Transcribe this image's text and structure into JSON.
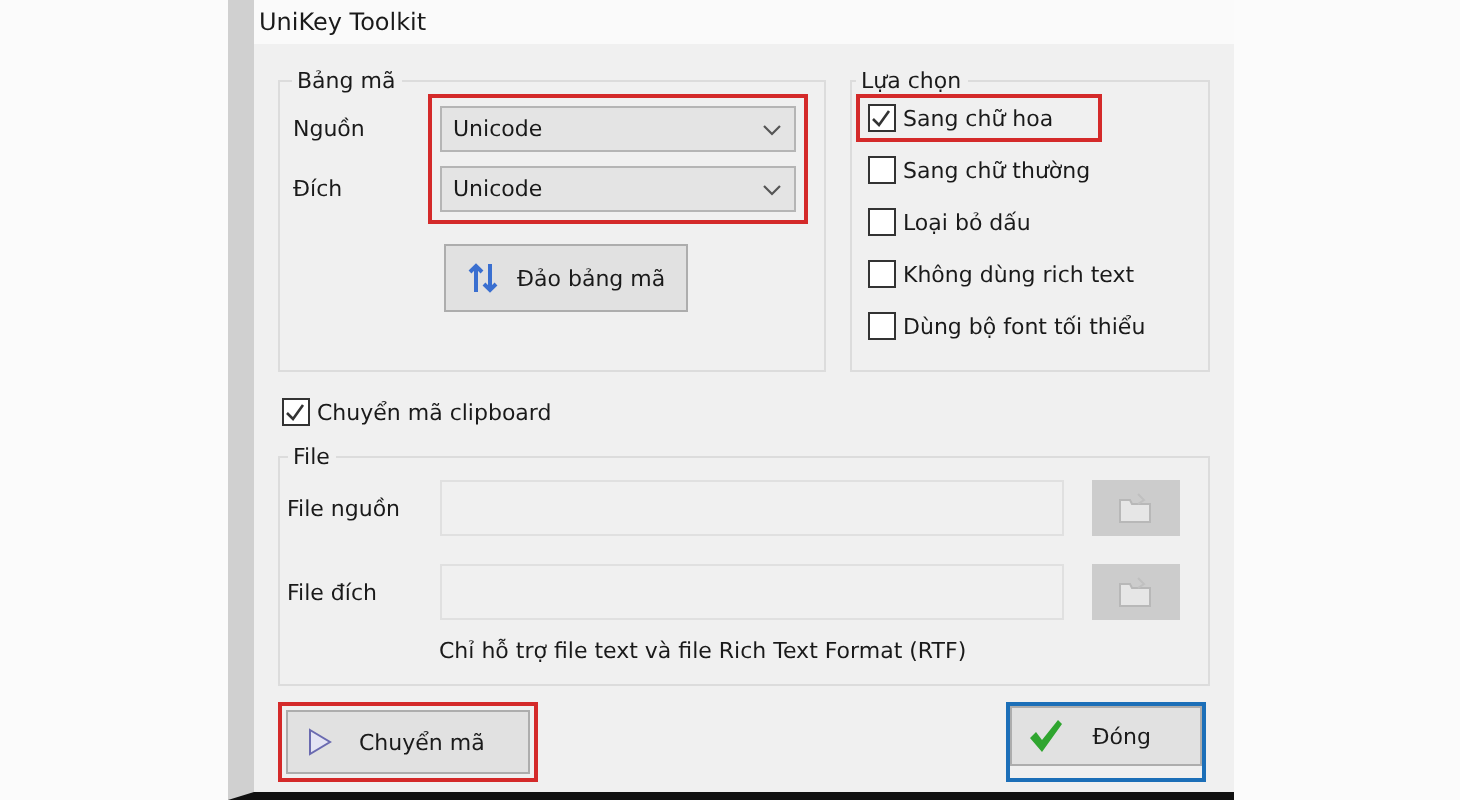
{
  "window": {
    "title": "UniKey Toolkit"
  },
  "code_table": {
    "label": "Bảng mã",
    "highlighted": true,
    "fields": [
      {
        "label": "Nguồn",
        "value": "Unicode"
      },
      {
        "label": "Đích",
        "value": "Unicode"
      }
    ],
    "swap_button": "Đảo bảng mã"
  },
  "options": {
    "label": "Lựa chọn",
    "items": [
      {
        "label": "Sang chữ hoa",
        "checked": true,
        "highlighted": true
      },
      {
        "label": "Sang chữ thường",
        "checked": false,
        "highlighted": false
      },
      {
        "label": "Loại bỏ dấu",
        "checked": false,
        "highlighted": false
      },
      {
        "label": "Không dùng rich text",
        "checked": false,
        "highlighted": false
      },
      {
        "label": "Dùng bộ font tối thiểu",
        "checked": false,
        "highlighted": false
      }
    ]
  },
  "clipboard": {
    "label": "Chuyển mã clipboard",
    "checked": true
  },
  "file": {
    "label": "File",
    "fields": [
      {
        "label": "File nguồn"
      },
      {
        "label": "File đích"
      }
    ],
    "note": "Chỉ hỗ trợ file text và file Rich Text Format (RTF)"
  },
  "buttons": [
    {
      "label": "Chuyển mã",
      "kind": "convert",
      "highlighted": true,
      "default": false
    },
    {
      "label": "Đóng",
      "kind": "close",
      "highlighted": false,
      "default": true
    }
  ]
}
